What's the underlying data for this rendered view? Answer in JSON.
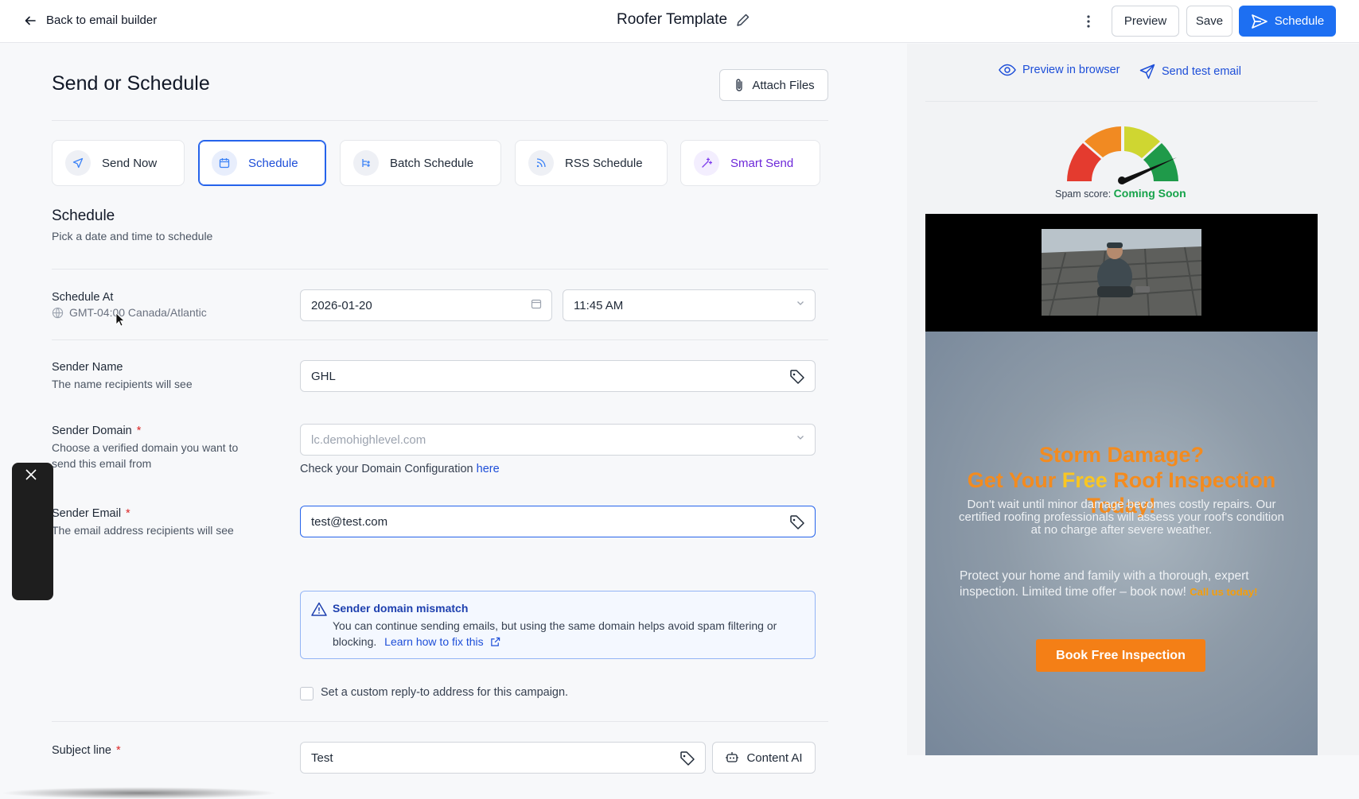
{
  "header": {
    "back_label": "Back to email builder",
    "title": "Roofer Template",
    "preview_label": "Preview",
    "save_label": "Save",
    "schedule_label": "Schedule"
  },
  "main": {
    "heading": "Send or Schedule",
    "attach_label": "Attach Files",
    "tabs": [
      {
        "label": "Send Now",
        "icon": "send-icon"
      },
      {
        "label": "Schedule",
        "icon": "calendar-icon",
        "active": true
      },
      {
        "label": "Batch Schedule",
        "icon": "batch-icon"
      },
      {
        "label": "RSS Schedule",
        "icon": "rss-icon"
      },
      {
        "label": "Smart Send",
        "icon": "sparkle-icon"
      }
    ],
    "section_title": "Schedule",
    "section_subtitle": "Pick a date and time to schedule",
    "schedule_at": {
      "label": "Schedule At",
      "timezone": "GMT-04:00 Canada/Atlantic",
      "date": "2026-01-20",
      "time": "11:45 AM"
    },
    "sender_name": {
      "label": "Sender Name",
      "sublabel": "The name recipients will see",
      "value": "GHL"
    },
    "sender_domain": {
      "label": "Sender Domain",
      "required": "*",
      "sublabel_line1": "Choose a verified domain you want to",
      "sublabel_line2": "send this email from",
      "placeholder": "lc.demohighlevel.com",
      "config_text": "Check your Domain Configuration",
      "config_link": "here"
    },
    "sender_email": {
      "label": "Sender Email",
      "required": "*",
      "sublabel": "The email address recipients will see",
      "value": "test@test.com"
    },
    "alert": {
      "title": "Sender domain mismatch",
      "message": "You can continue sending emails, but using the same domain helps avoid spam filtering or blocking.",
      "link": "Learn how to fix this"
    },
    "reply_to_label": "Set a custom reply-to address for this campaign.",
    "subject": {
      "label": "Subject line",
      "required": "*",
      "value": "Test",
      "content_ai_label": "Content AI"
    }
  },
  "preview": {
    "browser_label": "Preview in browser",
    "test_label": "Send test email",
    "spam_label": "Spam score:",
    "spam_value": "Coming Soon",
    "email": {
      "headline_line1": "Storm Damage?",
      "headline_line2a": "Get Your ",
      "headline_line2b": "Free",
      "headline_line2c": " Roof Inspection",
      "headline_line3": "Today!",
      "paragraph1": "Don't wait until minor damage becomes costly repairs. Our certified roofing professionals will assess your roof's condition at no charge after severe weather.",
      "paragraph2": "Protect your home and family with a thorough, expert inspection. Limited time offer – book now!",
      "call_text": "Call us today!",
      "cta": "Book Free Inspection"
    }
  },
  "colors": {
    "primary": "#1d6ff2",
    "accent_orange": "#f47f16",
    "spam_green": "#16a34a"
  }
}
